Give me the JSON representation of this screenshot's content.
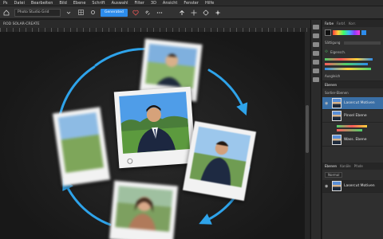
{
  "menubar": {
    "items": [
      "Ps",
      "Datei",
      "Bearbeiten",
      "Bild",
      "Ebene",
      "Schrift",
      "Auswahl",
      "Filter",
      "3D",
      "Ansicht",
      "Fenster",
      "Hilfe"
    ]
  },
  "options_bar": {
    "preset_value": "Photo Studio Grid",
    "primary_button": "Generated"
  },
  "document_tab": {
    "label": "ROD SOLAR-CREATE"
  },
  "panel": {
    "tabs": [
      "Farbe",
      "Farbf.",
      "Korr."
    ],
    "color_label": "Sättigung",
    "properties_title": "Eigensch.",
    "adjust_label": "Ausgleich",
    "layers_header": "Ebenen",
    "layers_filter": "Sortier-Ebenen",
    "layers": [
      {
        "name": "Lasercut Motiven",
        "selected": true
      },
      {
        "name": "Pinsel Ebene",
        "selected": false
      },
      {
        "name": "Wass. Ebene",
        "selected": false
      }
    ],
    "bottom_tabs": [
      "Ebenen",
      "Kanäle",
      "Pfade"
    ],
    "bottom_label": "Normal",
    "bottom_layer": "Lasercut Motiven"
  },
  "colors": {
    "accent": "#2d8ceb",
    "arrow": "#2ea3ea",
    "selection": "#3a6fa6"
  }
}
